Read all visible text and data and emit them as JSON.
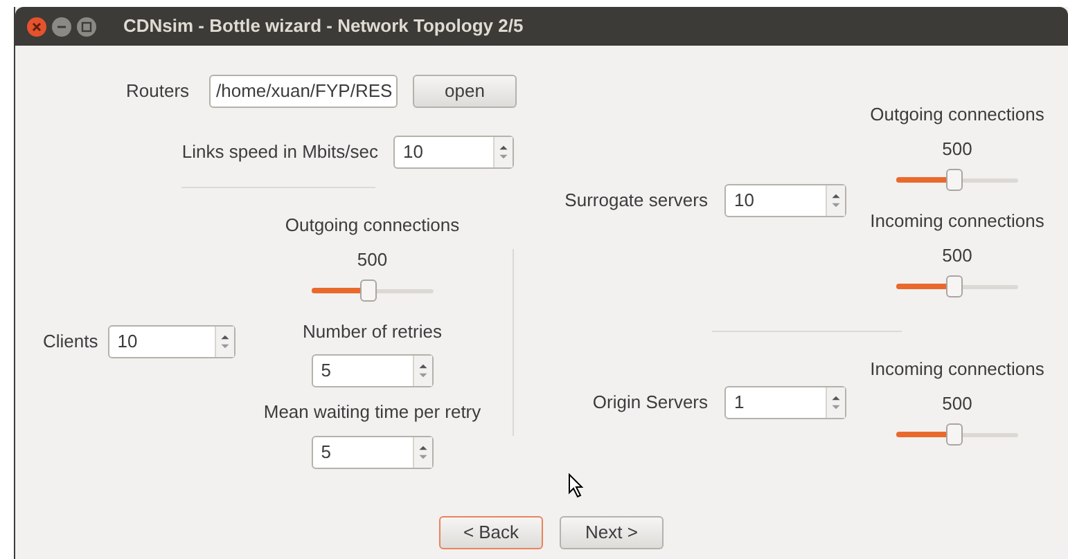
{
  "window": {
    "title": "CDNsim - Bottle wizard - Network Topology 2/5"
  },
  "routers": {
    "label": "Routers",
    "value": "/home/xuan/FYP/RES",
    "button": "open"
  },
  "links_speed": {
    "label": "Links speed in Mbits/sec",
    "value": "10"
  },
  "clients": {
    "label": "Clients",
    "value": "10",
    "outgoing": {
      "label": "Outgoing connections",
      "reading": "500",
      "level": 0.47
    },
    "retries": {
      "label": "Number of retries",
      "value": "5"
    },
    "waiting": {
      "label": "Mean waiting time per retry",
      "value": "5"
    }
  },
  "surrogate": {
    "label": "Surrogate servers",
    "value": "10",
    "outgoing": {
      "label": "Outgoing connections",
      "reading": "500",
      "level": 0.48
    },
    "incoming": {
      "label": "Incoming connections",
      "reading": "500",
      "level": 0.48
    }
  },
  "origin": {
    "label": "Origin Servers",
    "value": "1",
    "incoming": {
      "label": "Incoming connections",
      "reading": "500",
      "level": 0.48
    }
  },
  "buttons": [
    {
      "label": "< Back",
      "focused": true
    },
    {
      "label": "Next >",
      "focused": false
    }
  ]
}
